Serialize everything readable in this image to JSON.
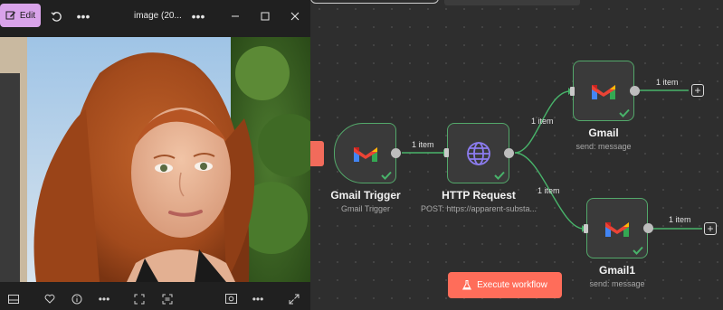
{
  "viewer": {
    "edit_label": "Edit",
    "image_title": "image (20...",
    "colors": {
      "edit_bg": "#d9a3ea",
      "bar_bg": "#202020"
    }
  },
  "workflow": {
    "nodes": {
      "gmail_trigger": {
        "title": "Gmail Trigger",
        "subtitle": "Gmail Trigger"
      },
      "http_request": {
        "title": "HTTP Request",
        "subtitle": "POST: https://apparent-substa..."
      },
      "gmail": {
        "title": "Gmail",
        "subtitle": "send: message"
      },
      "gmail1": {
        "title": "Gmail1",
        "subtitle": "send: message"
      }
    },
    "edges": {
      "trigger_to_http": "1 item",
      "http_to_gmail": "1 item",
      "http_to_gmail1": "1 item",
      "gmail_out": "1 item",
      "gmail1_out": "1 item"
    },
    "execute_label": "Execute workflow",
    "colors": {
      "success": "#53a86a",
      "accent": "#ff6d5a",
      "canvas": "#2e2e2e"
    }
  }
}
